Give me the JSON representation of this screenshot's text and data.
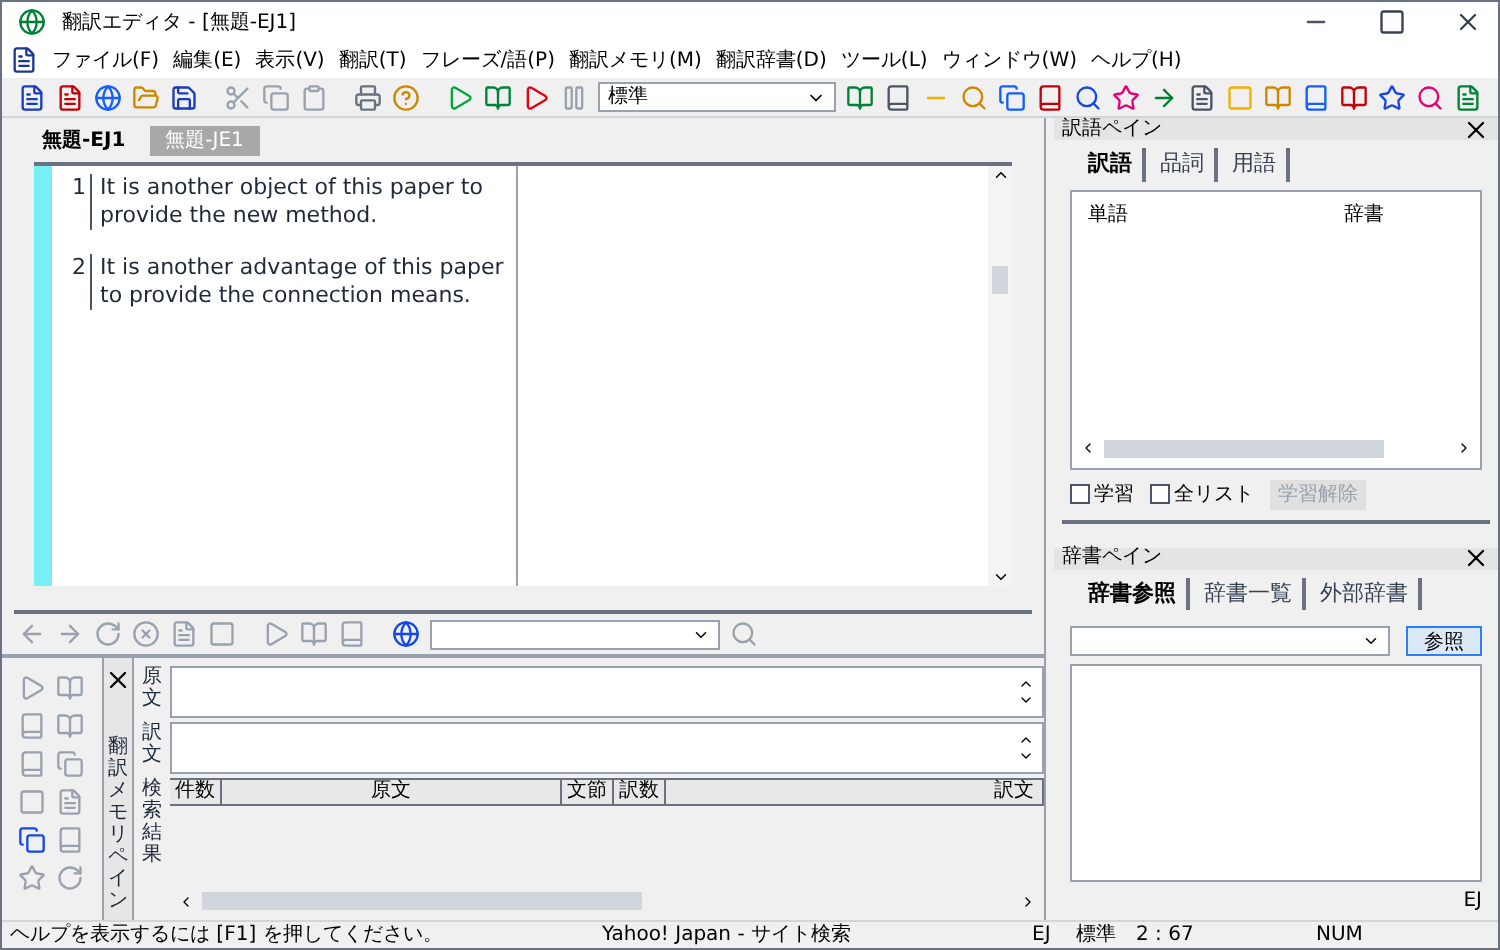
{
  "window": {
    "title": "翻訳エディタ - [無題-EJ1]"
  },
  "menu": [
    "ファイル(F)",
    "編集(E)",
    "表示(V)",
    "翻訳(T)",
    "フレーズ/語(P)",
    "翻訳メモリ(M)",
    "翻訳辞書(D)",
    "ツール(L)",
    "ウィンドウ(W)",
    "ヘルプ(H)"
  ],
  "toolbar": {
    "style_select": "標準"
  },
  "doc_tabs": [
    {
      "label": "無題-EJ1",
      "selected": true
    },
    {
      "label": "無題-JE1",
      "selected": false
    }
  ],
  "editor": {
    "rows": [
      {
        "number": "1",
        "source": "It is another object of this paper to provide the new method."
      },
      {
        "number": "2",
        "source": "It is another advantage of this paper to provide the connection means."
      }
    ]
  },
  "memory_pane": {
    "title": "翻訳メモリペイン",
    "source_label": "原文",
    "translation_label": "訳文",
    "results_label": "検索結果",
    "columns": [
      "件数",
      "原文",
      "文節",
      "訳数",
      "訳文"
    ]
  },
  "word_pane": {
    "title": "訳語ペイン",
    "tabs": [
      {
        "label": "訳語",
        "selected": true
      },
      {
        "label": "品詞",
        "selected": false
      },
      {
        "label": "用語",
        "selected": false
      }
    ],
    "columns": [
      "単語",
      "辞書"
    ],
    "checkboxes": [
      {
        "label": "学習",
        "checked": false
      },
      {
        "label": "全リスト",
        "checked": false
      }
    ],
    "learn_button": {
      "label": "学習解除",
      "disabled": true
    }
  },
  "dict_pane": {
    "title": "辞書ペイン",
    "tabs": [
      {
        "label": "辞書参照",
        "selected": true
      },
      {
        "label": "辞書一覧",
        "selected": false
      },
      {
        "label": "外部辞書",
        "selected": false
      }
    ],
    "lookup_button": "参照",
    "direction": "EJ"
  },
  "status_bar": {
    "help": "ヘルプを表示するには [F1] を押してください。",
    "search": "Yahoo! Japan - サイト検索",
    "direction": "EJ",
    "style": "標準",
    "position": "2 : 67",
    "num": "NUM"
  }
}
